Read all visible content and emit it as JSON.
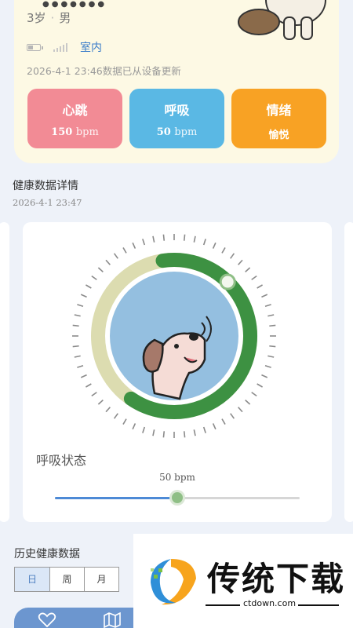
{
  "profile": {
    "name_hint": "●●●●●●●",
    "age": "3岁",
    "gender": "男",
    "battery_level": 0.4,
    "location": "室内",
    "update_text": "2026-4-1 23:46数据已从设备更新"
  },
  "stats": [
    {
      "title": "心跳",
      "value": "150",
      "unit": "bpm",
      "color": "#f28b95"
    },
    {
      "title": "呼吸",
      "value": "50",
      "unit": "bpm",
      "color": "#5ab8e4"
    },
    {
      "title": "情绪",
      "value": "愉悦",
      "unit": "",
      "color": "#f8a224"
    }
  ],
  "health_section": {
    "title": "健康数据详情",
    "time": "2026-4-1 23:47"
  },
  "breath_card": {
    "label": "呼吸状态",
    "value_text": "50 bpm",
    "gauge_fraction": 0.62,
    "slider_fraction": 0.5,
    "ring_color": "#3d9142",
    "ring_bg_color": "#dcdcb0"
  },
  "history": {
    "title": "历史健康数据",
    "tabs": [
      "日",
      "周",
      "月"
    ],
    "active_tab": 0
  },
  "watermark": {
    "title": "传统下载",
    "url": "ctdown.com"
  },
  "nav_icons": [
    "heart-icon",
    "map-icon"
  ]
}
